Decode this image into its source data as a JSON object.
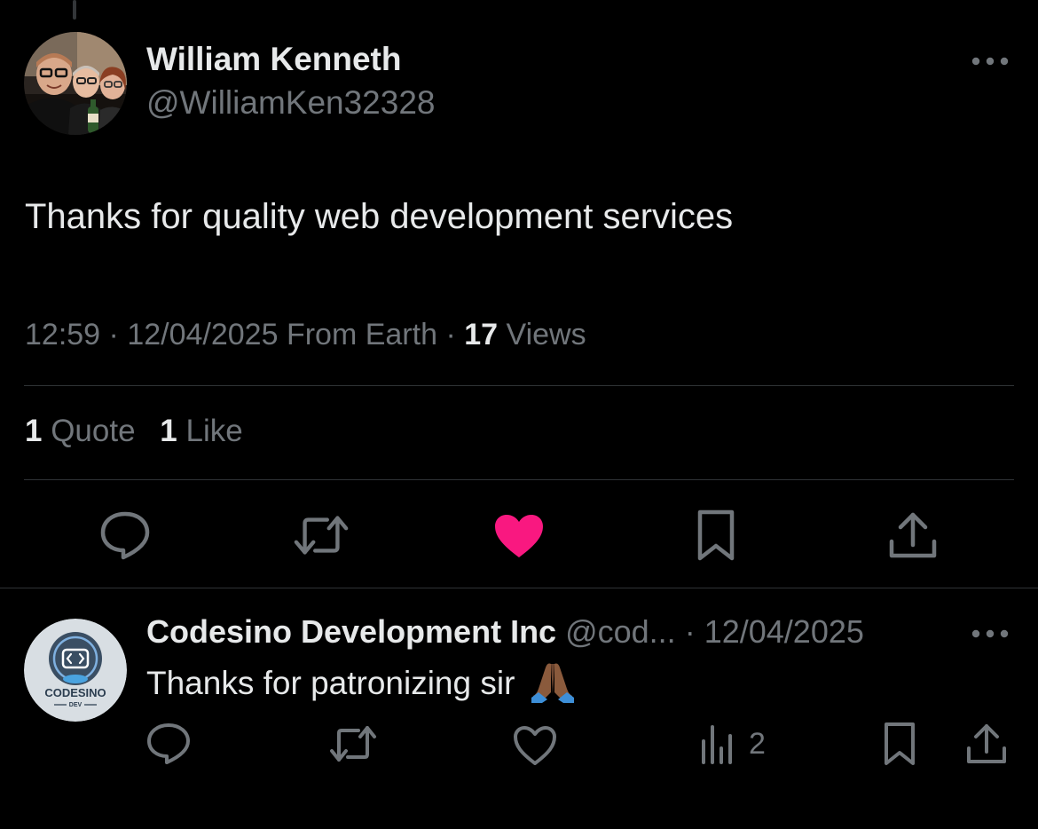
{
  "tweet": {
    "author_name": "William Kenneth",
    "author_handle": "@WilliamKen32328",
    "text": "Thanks for quality web development services",
    "time": "12:59",
    "date": "12/04/2025",
    "source": "From Earth",
    "views_count": "17",
    "views_label": "Views",
    "quotes_count": "1",
    "quotes_label": "Quote",
    "likes_count": "1",
    "likes_label": "Like",
    "liked": true
  },
  "reply": {
    "author_name": "Codesino Development Inc",
    "author_handle": "@cod...",
    "date": "12/04/2025",
    "text": "Thanks for patronizing sir",
    "emoji": "folded-hands",
    "views_count": "2",
    "avatar_logo_text": "CODESINO",
    "avatar_logo_subtext": "DEV"
  },
  "icons": {
    "reply": "reply-icon",
    "retweet": "retweet-icon",
    "like": "heart-icon",
    "bookmark": "bookmark-icon",
    "share": "share-icon",
    "views": "views-icon",
    "more": "more-icon"
  },
  "colors": {
    "background": "#000000",
    "text_primary": "#e7e9ea",
    "text_secondary": "#71767b",
    "divider": "#2f3336",
    "like_active": "#f91880"
  }
}
